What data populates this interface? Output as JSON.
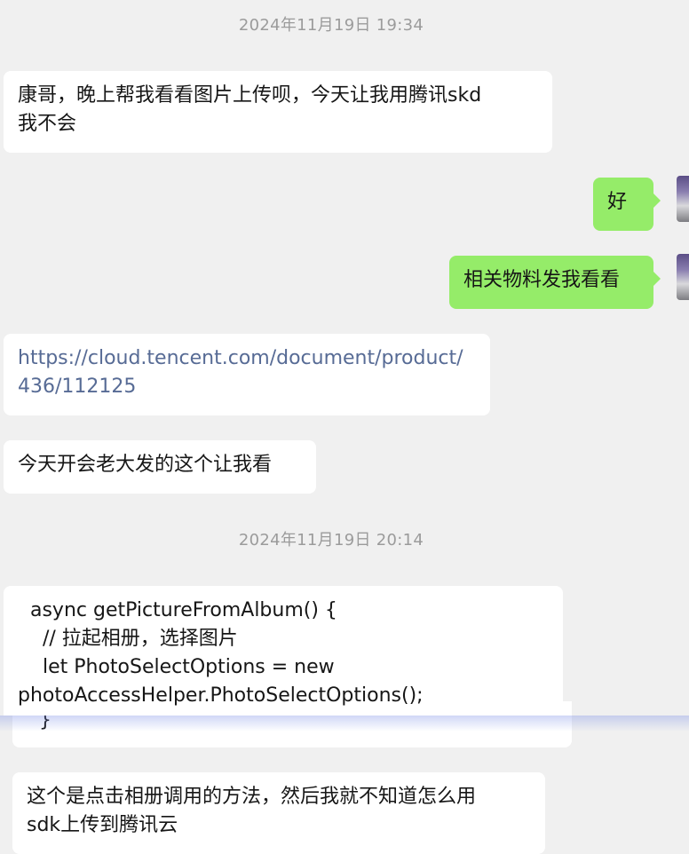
{
  "chat": {
    "timestamp1": "2024年11月19日 19:34",
    "timestamp2": "2024年11月19日 20:14",
    "msg1_line1": "康哥，晚上帮我看看图片上传呗，今天让我用腾讯skd",
    "msg1_line2": "我不会",
    "msg2": "好",
    "msg3": "相关物料发我看看",
    "msg4_line1": "https://cloud.tencent.com/document/product/",
    "msg4_line2": "436/112125",
    "msg5": "今天开会老大发的这个让我看",
    "code_lines": [
      "  async getPictureFromAlbum() {",
      "    // 拉起相册，选择图片",
      "    let PhotoSelectOptions = new",
      "photoAccessHelper.PhotoSelectOptions();"
    ],
    "code_tail": "  }",
    "msg7_line1": "这个是点击相册调用的方法，然后我就不知道怎么用",
    "msg7_line2": "sdk上传到腾讯云"
  },
  "colors": {
    "background": "#f0f0f0",
    "incoming_bubble": "#ffffff",
    "outgoing_bubble": "#95ec69",
    "link": "#576b95",
    "timestamp": "#9b9b9b"
  }
}
